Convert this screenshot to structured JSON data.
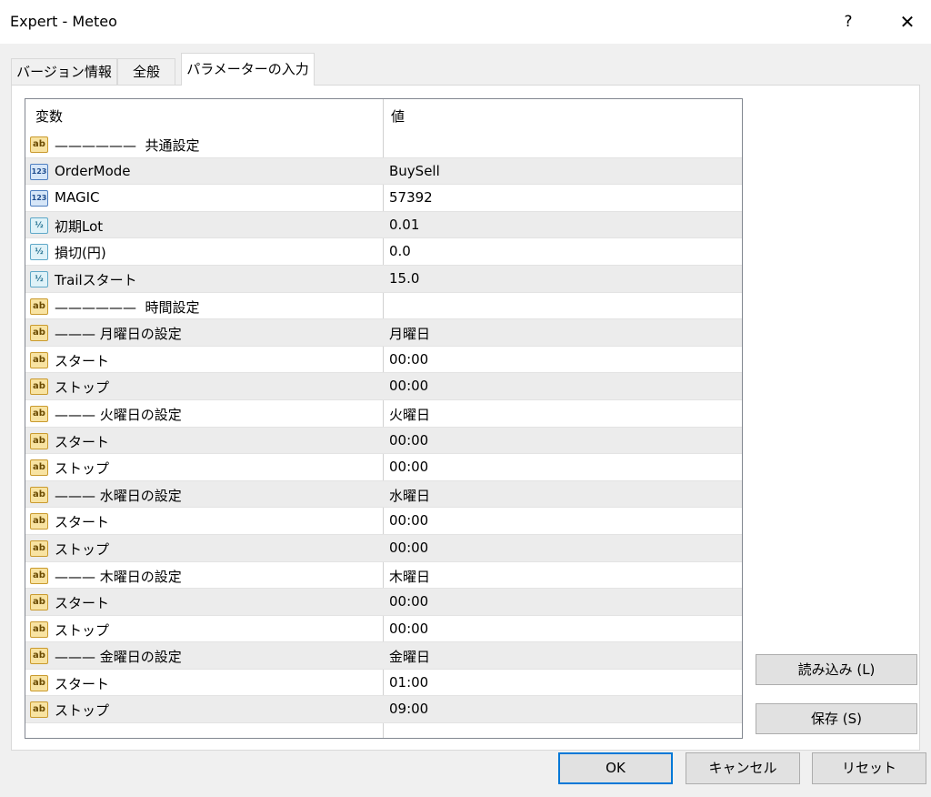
{
  "window": {
    "title": "Expert - Meteo",
    "help_label": "?",
    "close_label": "✕"
  },
  "tabs": [
    {
      "label": "バージョン情報"
    },
    {
      "label": "全般"
    },
    {
      "label": "パラメーターの入力"
    }
  ],
  "grid": {
    "headers": {
      "variable": "変数",
      "value": "値"
    },
    "rows": [
      {
        "type": "ab",
        "name": "——————  共通設定",
        "value": ""
      },
      {
        "type": "123",
        "name": "OrderMode",
        "value": "BuySell"
      },
      {
        "type": "123",
        "name": "MAGIC",
        "value": "57392"
      },
      {
        "type": "frac",
        "name": "初期Lot",
        "value": "0.01"
      },
      {
        "type": "frac",
        "name": "損切(円)",
        "value": "0.0"
      },
      {
        "type": "frac",
        "name": "Trailスタート",
        "value": "15.0"
      },
      {
        "type": "ab",
        "name": "——————  時間設定",
        "value": ""
      },
      {
        "type": "ab",
        "name": "——— 月曜日の設定",
        "value": "月曜日"
      },
      {
        "type": "ab",
        "name": "スタート",
        "value": "00:00"
      },
      {
        "type": "ab",
        "name": "ストップ",
        "value": "00:00"
      },
      {
        "type": "ab",
        "name": "——— 火曜日の設定",
        "value": "火曜日"
      },
      {
        "type": "ab",
        "name": "スタート",
        "value": "00:00"
      },
      {
        "type": "ab",
        "name": "ストップ",
        "value": "00:00"
      },
      {
        "type": "ab",
        "name": "——— 水曜日の設定",
        "value": "水曜日"
      },
      {
        "type": "ab",
        "name": "スタート",
        "value": "00:00"
      },
      {
        "type": "ab",
        "name": "ストップ",
        "value": "00:00"
      },
      {
        "type": "ab",
        "name": "——— 木曜日の設定",
        "value": "木曜日"
      },
      {
        "type": "ab",
        "name": "スタート",
        "value": "00:00"
      },
      {
        "type": "ab",
        "name": "ストップ",
        "value": "00:00"
      },
      {
        "type": "ab",
        "name": "——— 金曜日の設定",
        "value": "金曜日"
      },
      {
        "type": "ab",
        "name": "スタート",
        "value": "01:00"
      },
      {
        "type": "ab",
        "name": "ストップ",
        "value": "09:00"
      }
    ]
  },
  "icons": {
    "ab": "ab",
    "123": "123",
    "frac": "½"
  },
  "side_buttons": {
    "load_label": "読み込み (L)",
    "save_label": "保存 (S)"
  },
  "footer": {
    "ok_label": "OK",
    "cancel_label": "キャンセル",
    "reset_label": "リセット"
  }
}
